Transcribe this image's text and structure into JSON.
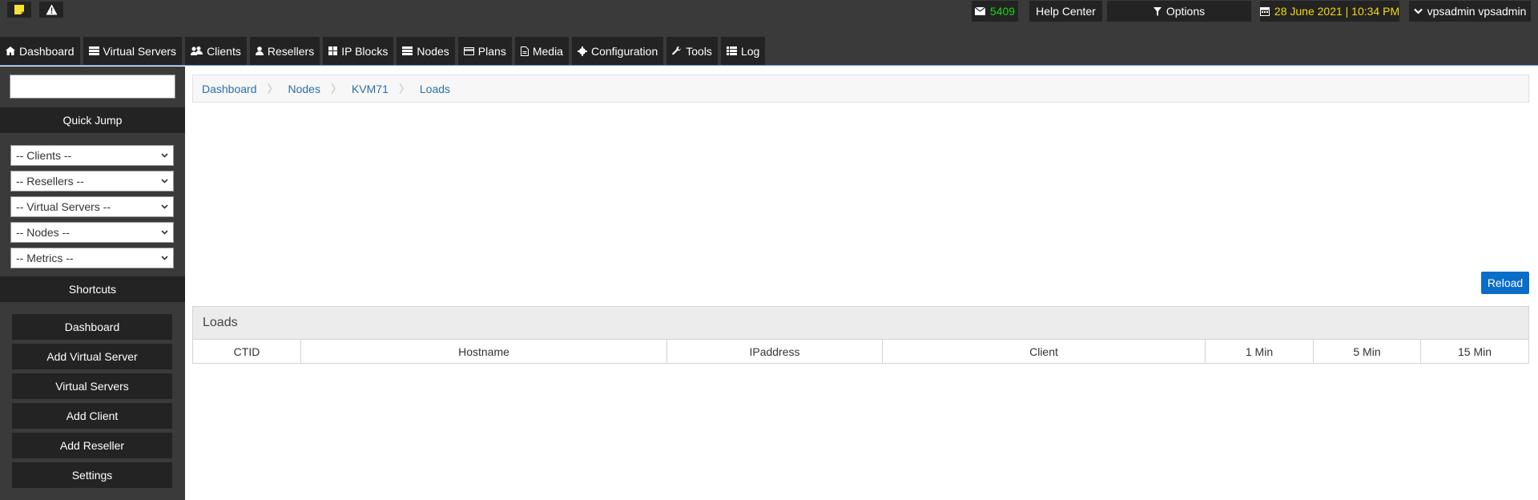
{
  "topbar": {
    "mail_count": "5409",
    "help_center": "Help Center",
    "options": "Options",
    "datetime": "28 June 2021 | 10:34 PM",
    "user": "vpsadmin vpsadmin",
    "colors": {
      "mail_count": "#19d619",
      "datetime": "#f5d90a",
      "note_icon": "#f7e23b"
    }
  },
  "nav": {
    "items": [
      {
        "label": "Dashboard",
        "icon": "home-icon"
      },
      {
        "label": "Virtual Servers",
        "icon": "server-icon"
      },
      {
        "label": "Clients",
        "icon": "users-icon"
      },
      {
        "label": "Resellers",
        "icon": "user-icon"
      },
      {
        "label": "IP Blocks",
        "icon": "grid-icon"
      },
      {
        "label": "Nodes",
        "icon": "server-icon"
      },
      {
        "label": "Plans",
        "icon": "card-icon"
      },
      {
        "label": "Media",
        "icon": "file-icon"
      },
      {
        "label": "Configuration",
        "icon": "gear-icon"
      },
      {
        "label": "Tools",
        "icon": "wrench-icon"
      },
      {
        "label": "Log",
        "icon": "list-icon"
      }
    ]
  },
  "sidebar": {
    "search_value": "",
    "quick_jump": "Quick Jump",
    "selects": [
      "-- Clients --",
      "-- Resellers --",
      "-- Virtual Servers --",
      "-- Nodes --",
      "-- Metrics --"
    ],
    "shortcuts_title": "Shortcuts",
    "shortcuts": [
      "Dashboard",
      "Add Virtual Server",
      "Virtual Servers",
      "Add Client",
      "Add Reseller",
      "Settings"
    ]
  },
  "breadcrumb": [
    "Dashboard",
    "Nodes",
    "KVM71",
    "Loads"
  ],
  "main": {
    "reload": "Reload",
    "panel_title": "Loads",
    "columns": [
      "CTID",
      "Hostname",
      "IPaddress",
      "Client",
      "1 Min",
      "5 Min",
      "15 Min"
    ],
    "rows": []
  }
}
